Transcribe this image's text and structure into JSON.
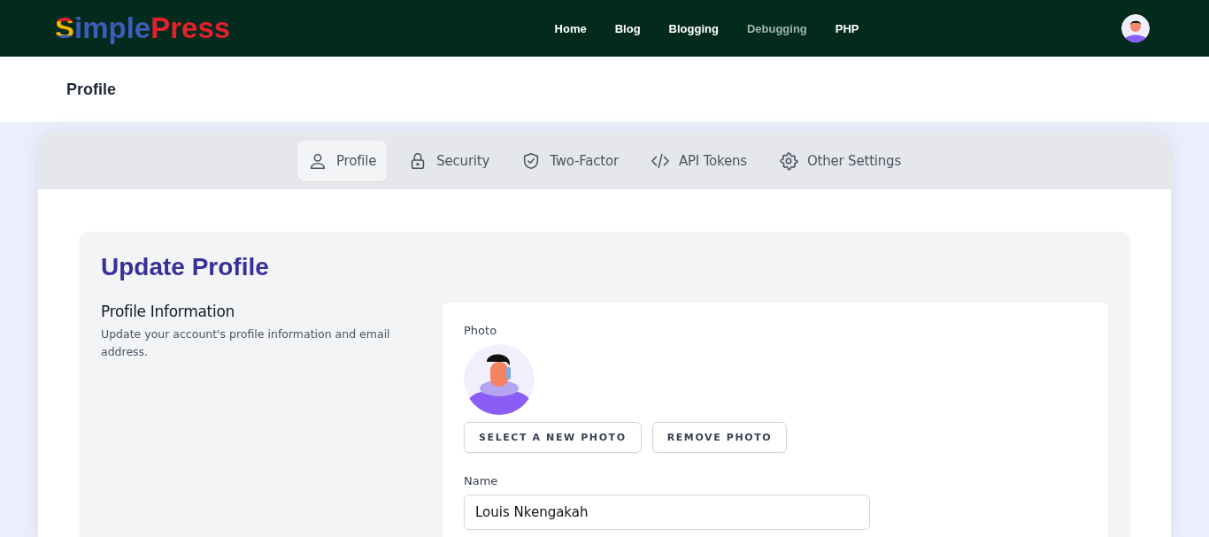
{
  "logo": {
    "parts": [
      {
        "text": "S",
        "kind": "mark"
      },
      {
        "text": "imple",
        "kind": "plain",
        "color": "#3f5bb8"
      },
      {
        "text": "Press",
        "kind": "plain",
        "color": "#e3202b"
      }
    ]
  },
  "nav": [
    {
      "label": "Home",
      "selected": false
    },
    {
      "label": "Blog",
      "selected": false
    },
    {
      "label": "Blogging",
      "selected": false
    },
    {
      "label": "Debugging",
      "selected": true
    },
    {
      "label": "PHP",
      "selected": false
    }
  ],
  "page_title": "Profile",
  "tabs": [
    {
      "label": "Profile",
      "selected": true
    },
    {
      "label": "Security",
      "selected": false
    },
    {
      "label": "Two-Factor",
      "selected": false
    },
    {
      "label": "API Tokens",
      "selected": false
    },
    {
      "label": "Other Settings",
      "selected": false
    }
  ],
  "form": {
    "title": "Update Profile",
    "section_title": "Profile Information",
    "section_description": "Update your account's profile information and email address.",
    "photo_label": "Photo",
    "buttons": [
      "SELECT A NEW PHOTO",
      "REMOVE PHOTO"
    ],
    "name_label": "Name",
    "name_value": "Louis Nkengakah"
  }
}
